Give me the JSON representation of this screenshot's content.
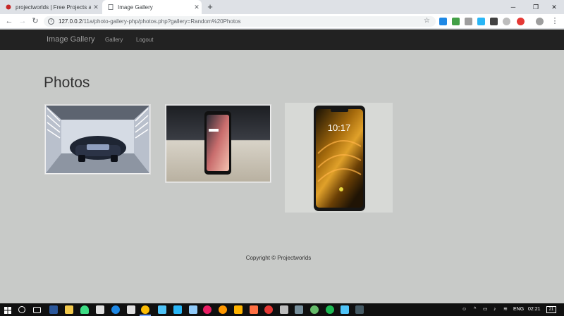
{
  "browser": {
    "tabs": [
      {
        "title": "projectworlds | Free Projects and",
        "active": false,
        "favicon_color": "#c62828"
      },
      {
        "title": "Image Gallery",
        "active": true
      }
    ],
    "address": {
      "host": "127.0.0.2",
      "path": "/11a/photo-gallery-php/photos.php?gallery=Random%20Photos"
    }
  },
  "site": {
    "brand": "Image Gallery",
    "nav": [
      "Gallery",
      "Logout"
    ],
    "heading": "Photos",
    "photos": [
      {
        "name": "bugatti-car-photo",
        "subject": "car"
      },
      {
        "name": "smartphone-on-table-photo",
        "subject": "phone"
      },
      {
        "name": "poco-phone-photo",
        "subject": "phone-front",
        "clock": "10:17"
      }
    ],
    "footer": "Copyright © Projectworlds"
  },
  "taskbar": {
    "language": "ENG",
    "time": "02:21",
    "notification_count": "21"
  },
  "colors": {
    "page_bg": "#c8cac8",
    "navbar_bg": "#222222",
    "nav_text": "#9d9d9d",
    "taskbar_bg": "#101010"
  }
}
